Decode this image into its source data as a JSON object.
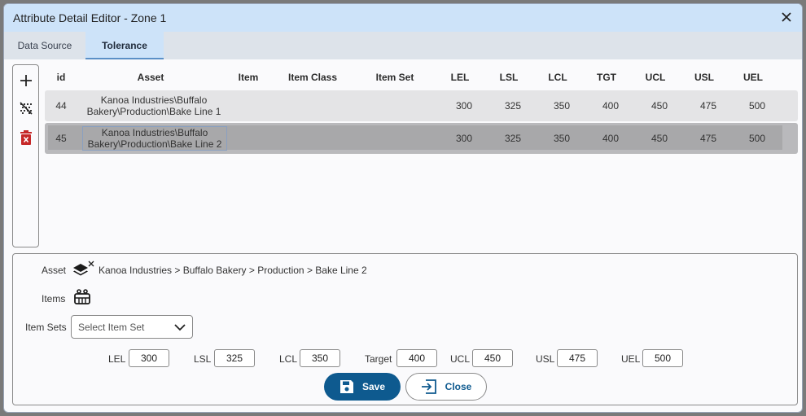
{
  "window": {
    "title": "Attribute Detail Editor - Zone 1"
  },
  "tabs": [
    {
      "label": "Data Source"
    },
    {
      "label": "Tolerance"
    }
  ],
  "toolbar": {
    "add_icon": "plus-icon",
    "clear_icon": "clear-filter-icon",
    "delete_icon": "trash-icon"
  },
  "grid": {
    "columns": [
      "id",
      "Asset",
      "Item",
      "Item Class",
      "Item Set",
      "LEL",
      "LSL",
      "LCL",
      "TGT",
      "UCL",
      "USL",
      "UEL"
    ],
    "rows": [
      {
        "id": "44",
        "asset": "Kanoa Industries\\Buffalo Bakery\\Production\\Bake Line 1",
        "item": "",
        "item_class": "",
        "item_set": "",
        "lel": "300",
        "lsl": "325",
        "lcl": "350",
        "tgt": "400",
        "ucl": "450",
        "usl": "475",
        "uel": "500"
      },
      {
        "id": "45",
        "asset": "Kanoa Industries\\Buffalo Bakery\\Production\\Bake Line 2",
        "item": "",
        "item_class": "",
        "item_set": "",
        "lel": "300",
        "lsl": "325",
        "lcl": "350",
        "tgt": "400",
        "ucl": "450",
        "usl": "475",
        "uel": "500"
      }
    ]
  },
  "detail": {
    "asset_label": "Asset",
    "asset_path": "Kanoa Industries > Buffalo Bakery > Production > Bake Line 2",
    "items_label": "Items",
    "item_sets_label": "Item Sets",
    "item_set_placeholder": "Select Item Set",
    "limits": {
      "lel_label": "LEL",
      "lel": "300",
      "lsl_label": "LSL",
      "lsl": "325",
      "lcl_label": "LCL",
      "lcl": "350",
      "target_label": "Target",
      "target": "400",
      "ucl_label": "UCL",
      "ucl": "450",
      "usl_label": "USL",
      "usl": "475",
      "uel_label": "UEL",
      "uel": "500"
    },
    "save_label": "Save",
    "close_label": "Close"
  },
  "colors": {
    "accent": "#0e5a8f",
    "titlebar": "#cde3f9",
    "delete": "#c62828"
  }
}
